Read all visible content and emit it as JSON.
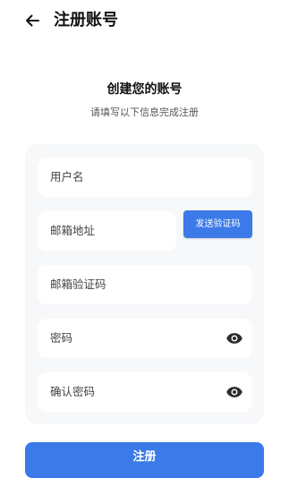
{
  "header": {
    "title": "注册账号",
    "back_icon": "arrow-left-icon"
  },
  "intro": {
    "heading": "创建您的账号",
    "subheading": "请填写以下信息完成注册"
  },
  "form": {
    "username_label": "用户名",
    "email_label": "邮箱地址",
    "send_code_label": "发送验证码",
    "email_code_label": "邮箱验证码",
    "password_label": "密码",
    "confirm_password_label": "确认密码",
    "visibility_icon": "eye-icon"
  },
  "submit": {
    "label": "注册"
  },
  "colors": {
    "accent": "#3b7ae8",
    "card_background": "#f7f8fa",
    "field_background": "#ffffff"
  }
}
